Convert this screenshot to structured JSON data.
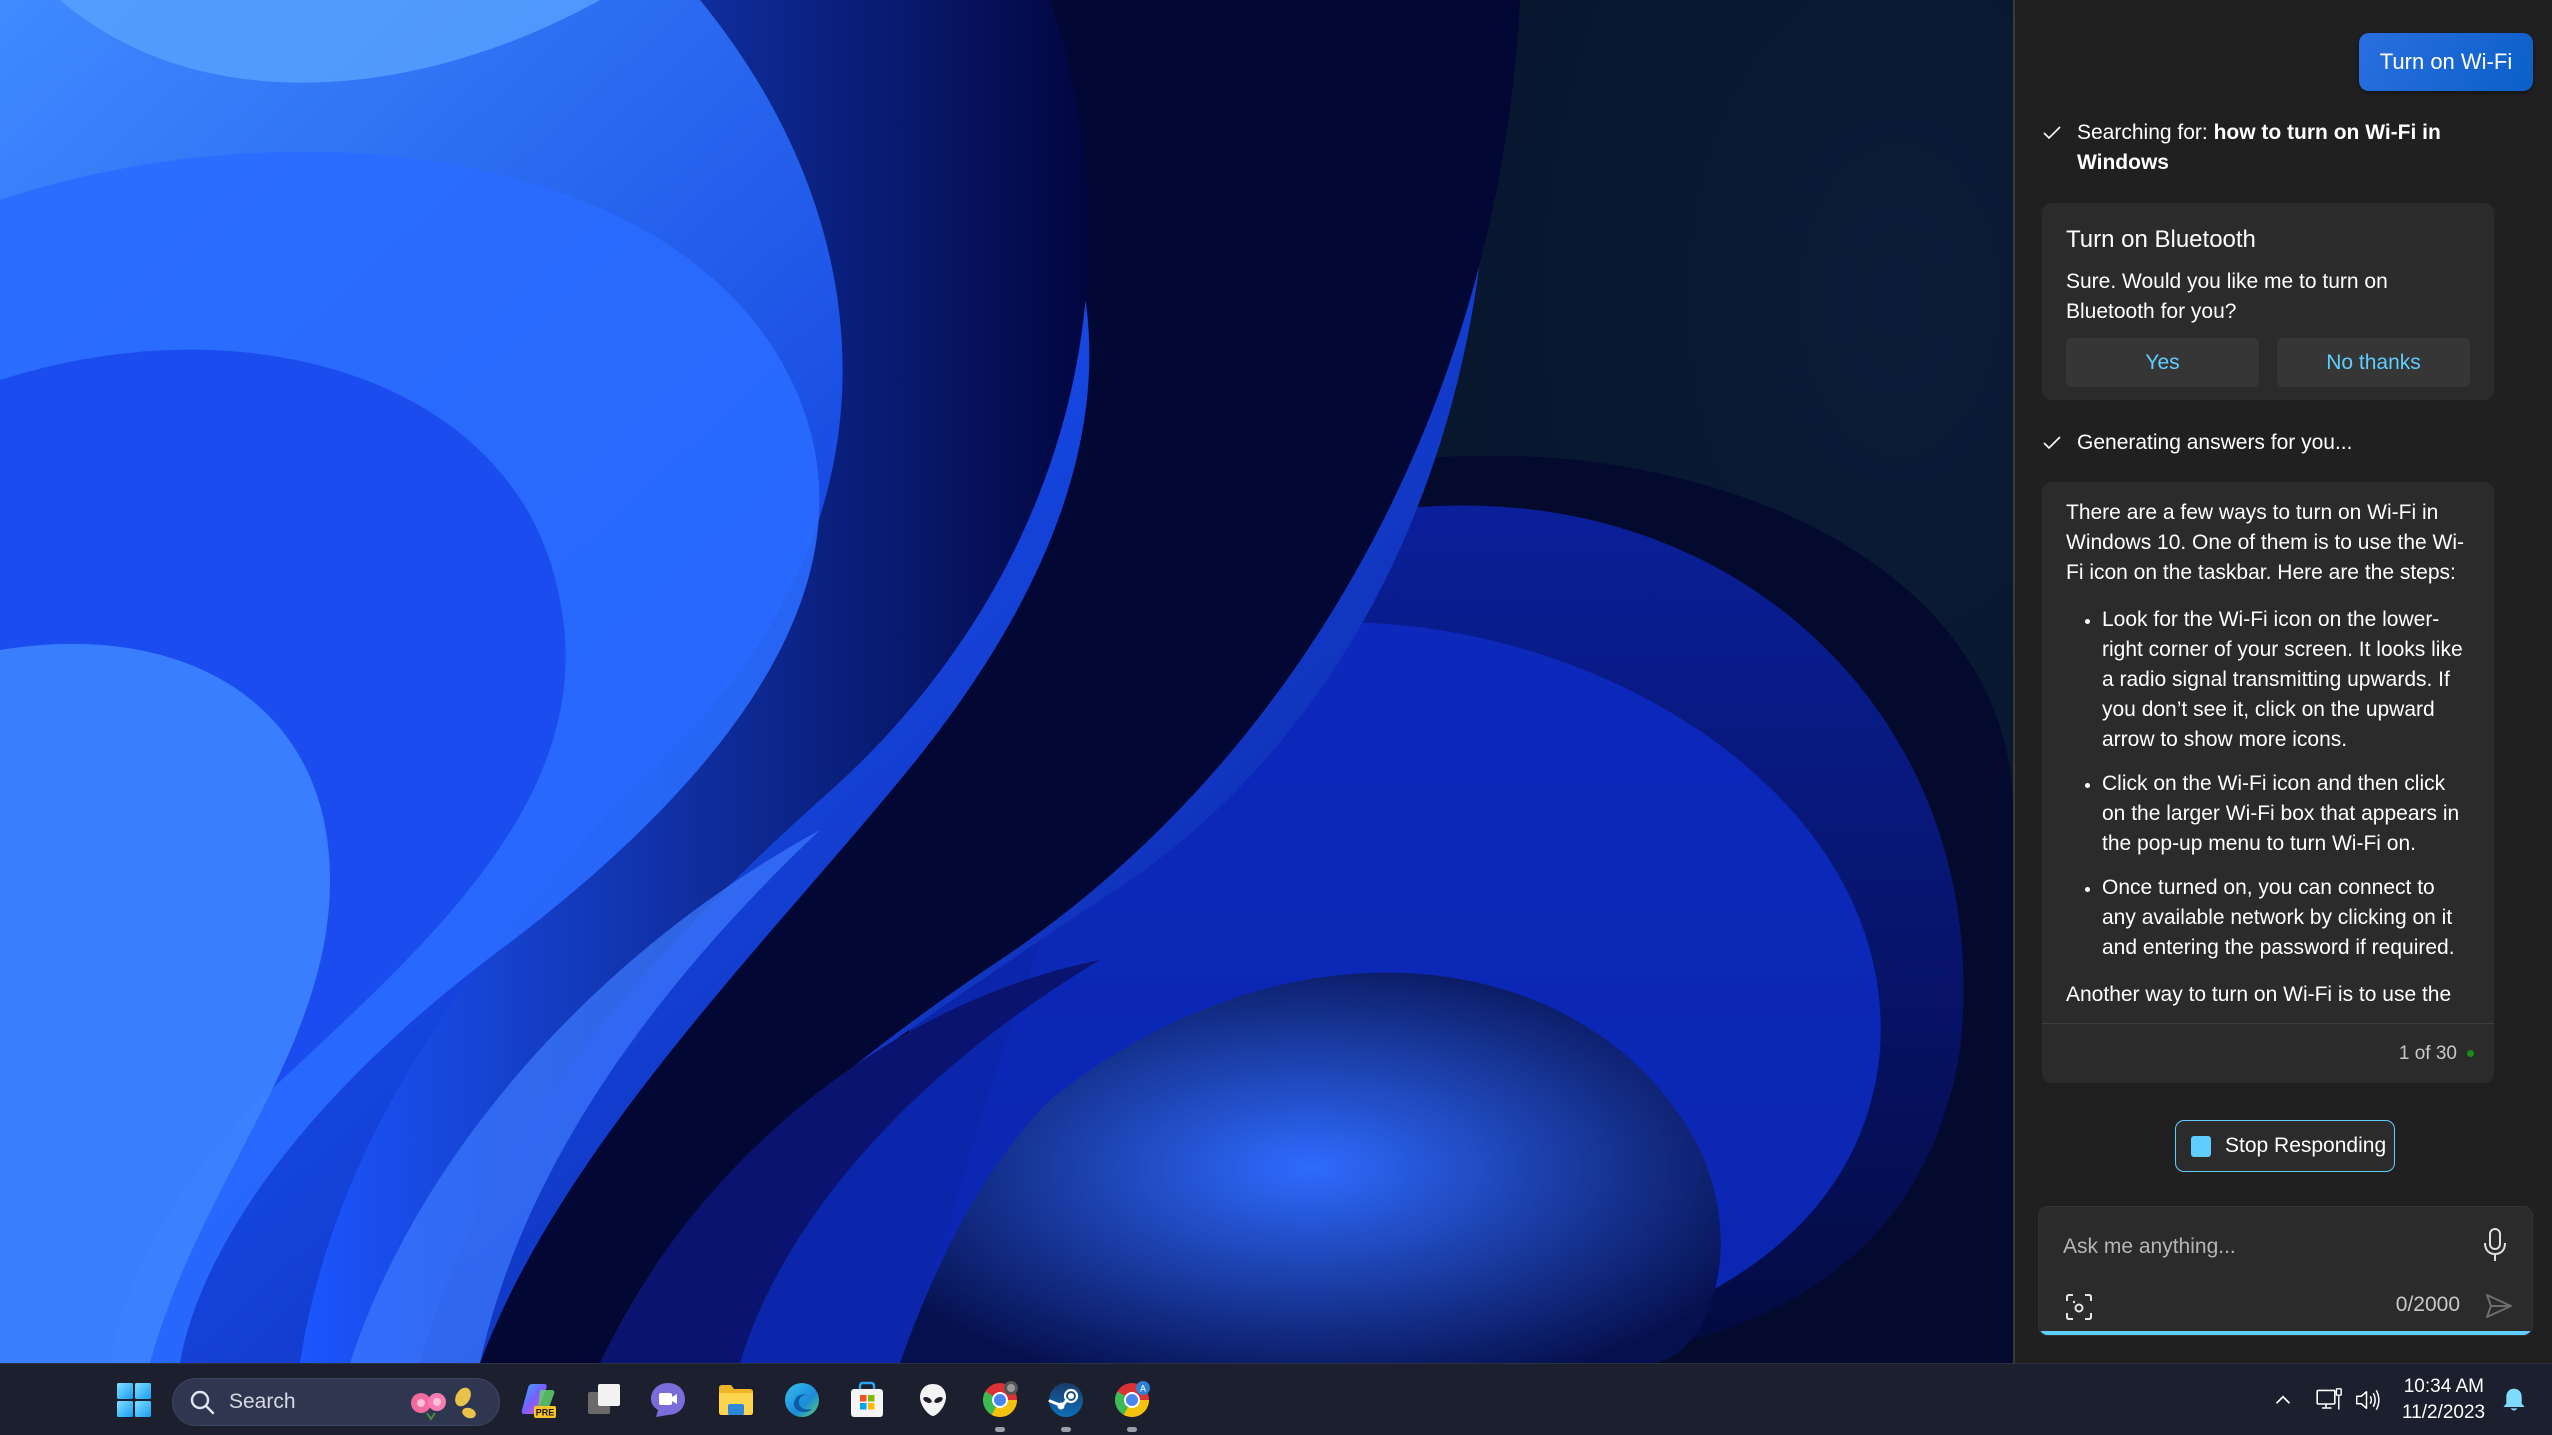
{
  "copilot": {
    "user_message": "Turn on Wi-Fi",
    "search_status": {
      "prefix": "Searching for: ",
      "query": "how to turn on Wi-Fi in Windows"
    },
    "bluetooth_card": {
      "title": "Turn on Bluetooth",
      "body": "Sure. Would you like me to turn on Bluetooth for you?",
      "yes_label": "Yes",
      "no_label": "No thanks"
    },
    "generating_status": "Generating answers for you...",
    "answer": {
      "intro": "There are a few ways to turn on Wi-Fi in Windows 10. One of them is to use the Wi-Fi icon on the taskbar. Here are the steps:",
      "steps": [
        "Look for the Wi-Fi icon on the lower-right corner of your screen. It looks like a radio signal transmitting upwards. If you don’t see it, click on the upward arrow to show more icons.",
        "Click on the Wi-Fi icon and then click on the larger Wi-Fi box that appears in the pop-up menu to turn Wi-Fi on.",
        "Once turned on, you can connect to any available network by clicking on it and entering the password if required."
      ],
      "outro": "Another way to turn on Wi-Fi is to use the",
      "page_count": "1 of 30"
    },
    "stop_label": "Stop Responding",
    "input": {
      "placeholder": "Ask me anything...",
      "value": "",
      "char_count": "0/2000"
    },
    "accent_color": "#60cdff",
    "bubble_color": "#1f6bd8"
  },
  "taskbar": {
    "search_label": "Search",
    "apps": [
      {
        "name": "copilot",
        "icon": "copilot-pre-icon",
        "badge": "PRE"
      },
      {
        "name": "task-view",
        "icon": "task-view-icon"
      },
      {
        "name": "teams-chat",
        "icon": "teams-chat-icon"
      },
      {
        "name": "file-explorer",
        "icon": "folder-icon"
      },
      {
        "name": "edge",
        "icon": "edge-icon"
      },
      {
        "name": "microsoft-store",
        "icon": "store-icon"
      },
      {
        "name": "alienware",
        "icon": "alien-icon"
      },
      {
        "name": "chrome-profile-1",
        "icon": "chrome-icon",
        "running": true
      },
      {
        "name": "steam",
        "icon": "steam-icon",
        "running": true
      },
      {
        "name": "chrome-profile-2",
        "icon": "chrome-icon",
        "badge": "A",
        "running": true
      }
    ],
    "clock": {
      "time": "10:34 AM",
      "date": "11/2/2023"
    }
  }
}
